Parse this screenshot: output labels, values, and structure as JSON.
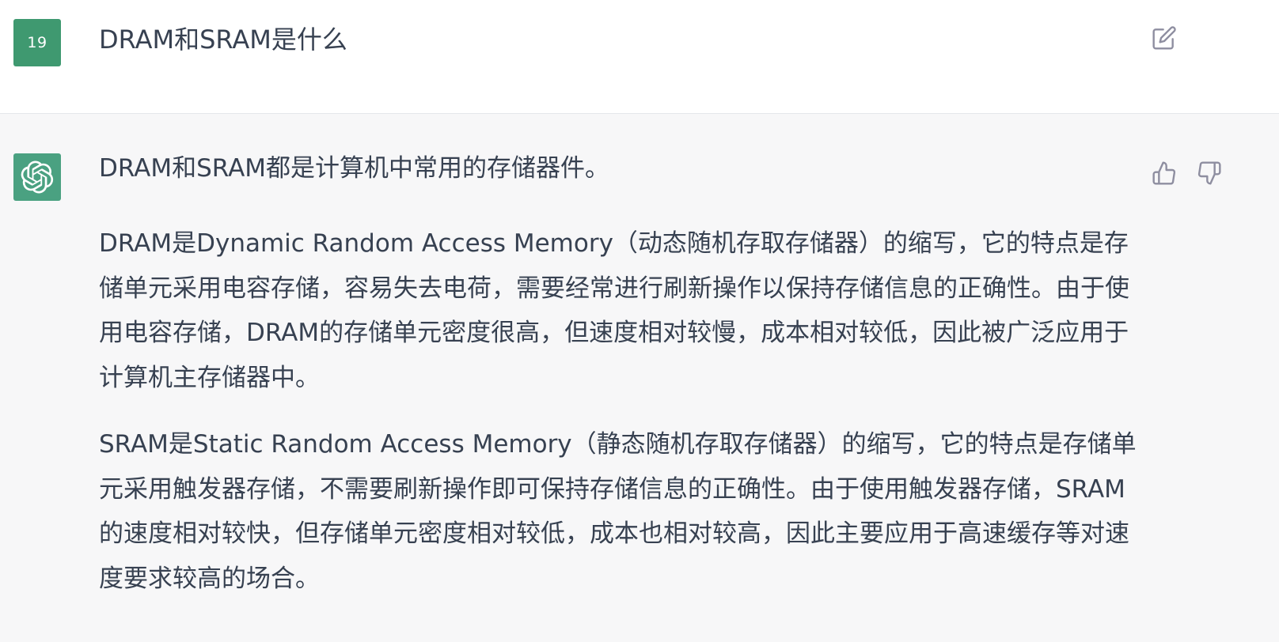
{
  "user_message": {
    "avatar_label": "19",
    "text": "DRAM和SRAM是什么"
  },
  "assistant_message": {
    "paragraphs": [
      "DRAM和SRAM都是计算机中常用的存储器件。",
      "DRAM是Dynamic Random Access Memory（动态随机存取存储器）的缩写，它的特点是存储单元采用电容存储，容易失去电荷，需要经常进行刷新操作以保持存储信息的正确性。由于使用电容存储，DRAM的存储单元密度很高，但速度相对较慢，成本相对较低，因此被广泛应用于计算机主存储器中。",
      "SRAM是Static Random Access Memory（静态随机存取存储器）的缩写，它的特点是存储单元采用触发器存储，不需要刷新操作即可保持存储信息的正确性。由于使用触发器存储，SRAM的速度相对较快，但存储单元密度相对较低，成本也相对较高，因此主要应用于高速缓存等对速度要求较高的场合。"
    ]
  },
  "icons": {
    "edit": "edit-icon",
    "thumbs_up": "thumbs-up-icon",
    "thumbs_down": "thumbs-down-icon",
    "assistant_logo": "openai-logo-icon"
  },
  "colors": {
    "user_avatar_bg": "#3f9970",
    "assistant_avatar_bg": "#4aa181",
    "assistant_row_bg": "#f7f7f8",
    "text": "#374151",
    "icon": "#8e8ea0"
  }
}
